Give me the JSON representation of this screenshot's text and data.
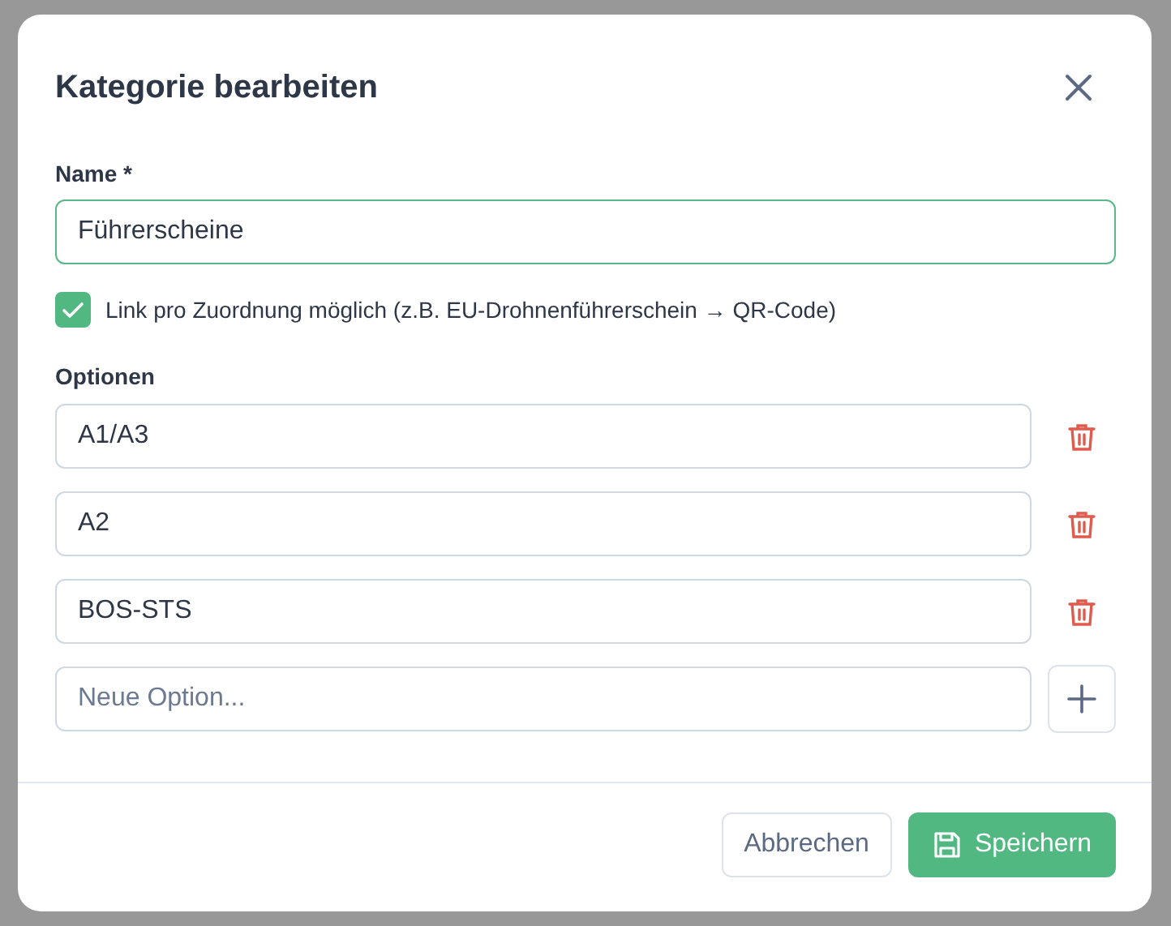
{
  "dialog": {
    "title": "Kategorie bearbeiten"
  },
  "name_field": {
    "label": "Name *",
    "value": "Führerscheine",
    "focused": true
  },
  "link_option": {
    "label": "Link pro Zuordnung möglich (z.B. EU-Drohnenführerschein → QR-Code)",
    "checked": true
  },
  "options": {
    "label": "Optionen",
    "items": [
      {
        "value": "A1/A3"
      },
      {
        "value": "A2"
      },
      {
        "value": "BOS-STS"
      }
    ],
    "new_option": {
      "placeholder": "Neue Option..."
    }
  },
  "buttons": [
    {
      "kind": "secondary",
      "label": "Abbrechen"
    },
    {
      "kind": "primary",
      "label": "Speichern"
    }
  ]
}
